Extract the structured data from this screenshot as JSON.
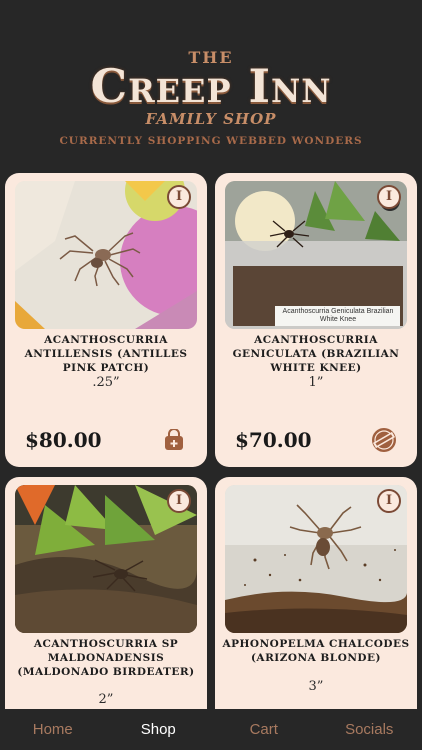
{
  "header": {
    "the": "THE",
    "brand": "Creep Inn",
    "family": "FAMILY SHOP",
    "subtitle": "CURRENTLY SHOPPING WEBBED WONDERS"
  },
  "products": [
    {
      "name": "ACANTHOSCURRIA ANTILLENSIS (ANTILLES PINK PATCH)",
      "size": ".25”",
      "price": "$80.00",
      "action_icon": "shopping-bag-icon",
      "info_label": "I",
      "photo_label": ""
    },
    {
      "name": "ACANTHOSCURRIA GENICULATA (BRAZILIAN WHITE KNEE)",
      "size": "1”",
      "price": "$70.00",
      "action_icon": "sold-out-icon",
      "info_label": "I",
      "photo_label": "Acanthoscurria Geniculata Brazilian White Knee"
    },
    {
      "name": "ACANTHOSCURRIA SP MALDONADENSIS (MALDONADO BIRDEATER)",
      "size": "2”",
      "price": "",
      "action_icon": "",
      "info_label": "I",
      "photo_label": ""
    },
    {
      "name": "APHONOPELMA CHALCODES (ARIZONA BLONDE)",
      "size": "3”",
      "price": "",
      "action_icon": "",
      "info_label": "I",
      "photo_label": ""
    }
  ],
  "tabs": [
    {
      "label": "Home",
      "active": false
    },
    {
      "label": "Shop",
      "active": true
    },
    {
      "label": "Cart",
      "active": false
    },
    {
      "label": "Socials",
      "active": false
    }
  ],
  "colors": {
    "background": "#272727",
    "card": "#fbe9de",
    "accent": "#a87a60",
    "brand": "#f3e4d6"
  }
}
